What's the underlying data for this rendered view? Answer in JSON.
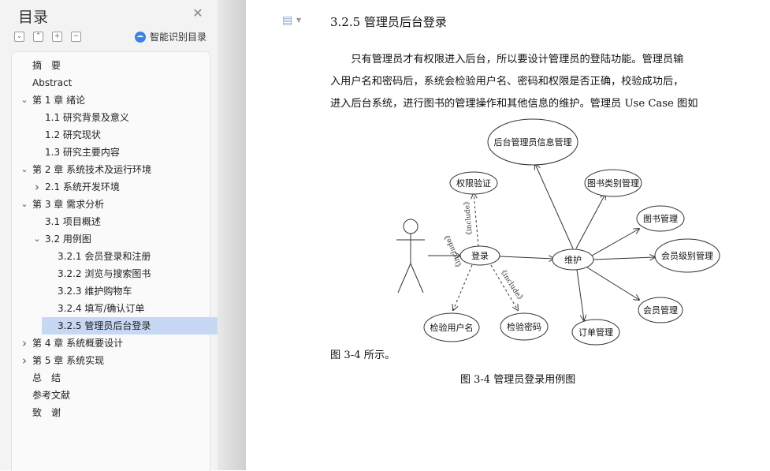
{
  "sidebar": {
    "title": "目录",
    "smart_label": "智能识别目录",
    "tool_icons": [
      "collapse-all-icon",
      "expand-up-icon",
      "add-icon",
      "remove-icon"
    ],
    "items": [
      {
        "label": "摘　要",
        "level": 0,
        "chev": ""
      },
      {
        "label": "Abstract",
        "level": 0,
        "chev": ""
      },
      {
        "label": "第 1 章  绪论",
        "level": 0,
        "chev": "v"
      },
      {
        "label": "1.1  研究背景及意义",
        "level": 1,
        "chev": ""
      },
      {
        "label": "1.2  研究现状",
        "level": 1,
        "chev": ""
      },
      {
        "label": "1.3  研究主要内容",
        "level": 1,
        "chev": ""
      },
      {
        "label": "第 2 章  系统技术及运行环境",
        "level": 0,
        "chev": "v"
      },
      {
        "label": "2.1 系统开发环境",
        "level": 1,
        "chev": ">"
      },
      {
        "label": "第 3 章  需求分析",
        "level": 0,
        "chev": "v"
      },
      {
        "label": "3.1 项目概述",
        "level": 1,
        "chev": ""
      },
      {
        "label": "3.2  用例图",
        "level": 1,
        "chev": "v"
      },
      {
        "label": "3.2.1 会员登录和注册",
        "level": 2,
        "chev": ""
      },
      {
        "label": "3.2.2 浏览与搜索图书",
        "level": 2,
        "chev": ""
      },
      {
        "label": "3.2.3 维护购物车",
        "level": 2,
        "chev": ""
      },
      {
        "label": "3.2.4 填写/确认订单",
        "level": 2,
        "chev": ""
      },
      {
        "label": "3.2.5 管理员后台登录",
        "level": 2,
        "chev": "",
        "active": true
      },
      {
        "label": "第 4 章  系统概要设计",
        "level": 0,
        "chev": ">"
      },
      {
        "label": "第 5 章  系统实现",
        "level": 0,
        "chev": ">"
      },
      {
        "label": "总　结",
        "level": 0,
        "chev": ""
      },
      {
        "label": "参考文献",
        "level": 0,
        "chev": ""
      },
      {
        "label": "致　谢",
        "level": 0,
        "chev": ""
      }
    ]
  },
  "doc": {
    "heading": "3.2.5 管理员后台登录",
    "lines": [
      "　　只有管理员才有权限进入后台，所以要设计管理员的登陆功能。管理员输",
      "入用户名和密码后，系统会检验用户名、密码和权限是否正确，校验成功后，",
      "进入后台系统，进行图书的管理操作和其他信息的维护。管理员 Use Case 图如"
    ],
    "after_figure": "图 3-4 所示。",
    "caption": "图  3-4  管理员登录用例图"
  },
  "diagram": {
    "login": "登录",
    "maintain": "维护",
    "perm": "权限验证",
    "check_user": "检验用户名",
    "check_pwd": "检验密码",
    "admin_info": "后台管理员信息管理",
    "book_category": "图书类别管理",
    "book_mgmt": "图书管理",
    "member_level": "会员级别管理",
    "member_mgmt": "会员管理",
    "order_mgmt": "订单管理",
    "include": "《include》"
  }
}
